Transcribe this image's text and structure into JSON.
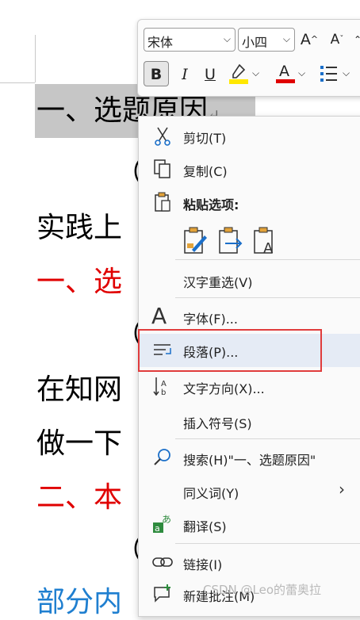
{
  "document": {
    "heading1_selected": "一、选题原因",
    "heading1_tail": "↵",
    "line2": "（",
    "line3": "实践上",
    "line4": "一、选",
    "line5": "（",
    "line6": "在知网",
    "line7": "做一下",
    "line8": "二、本",
    "line9": "（",
    "line10": "部分内"
  },
  "mini_toolbar": {
    "font_name": "宋体",
    "font_size": "小四",
    "grow_font": "A",
    "shrink_font": "A",
    "bold": "B",
    "italic": "I",
    "underline": "U",
    "font_color": "A",
    "highlight_color": "#ffe800",
    "font_color_value": "#e00000"
  },
  "context_menu": {
    "cut": "剪切(T)",
    "copy": "复制(C)",
    "paste_options": "粘贴选项:",
    "reconvert": "汉字重选(V)",
    "font": "字体(F)...",
    "paragraph": "段落(P)...",
    "text_direction": "文字方向(X)...",
    "insert_symbol": "插入符号(S)",
    "search": "搜索(H)\"一、选题原因\"",
    "synonyms": "同义词(Y)",
    "translate": "翻译(S)",
    "link": "链接(I)",
    "new_comment": "新建批注(M)"
  },
  "watermark": "CSDN @Leo的蕾奥拉"
}
